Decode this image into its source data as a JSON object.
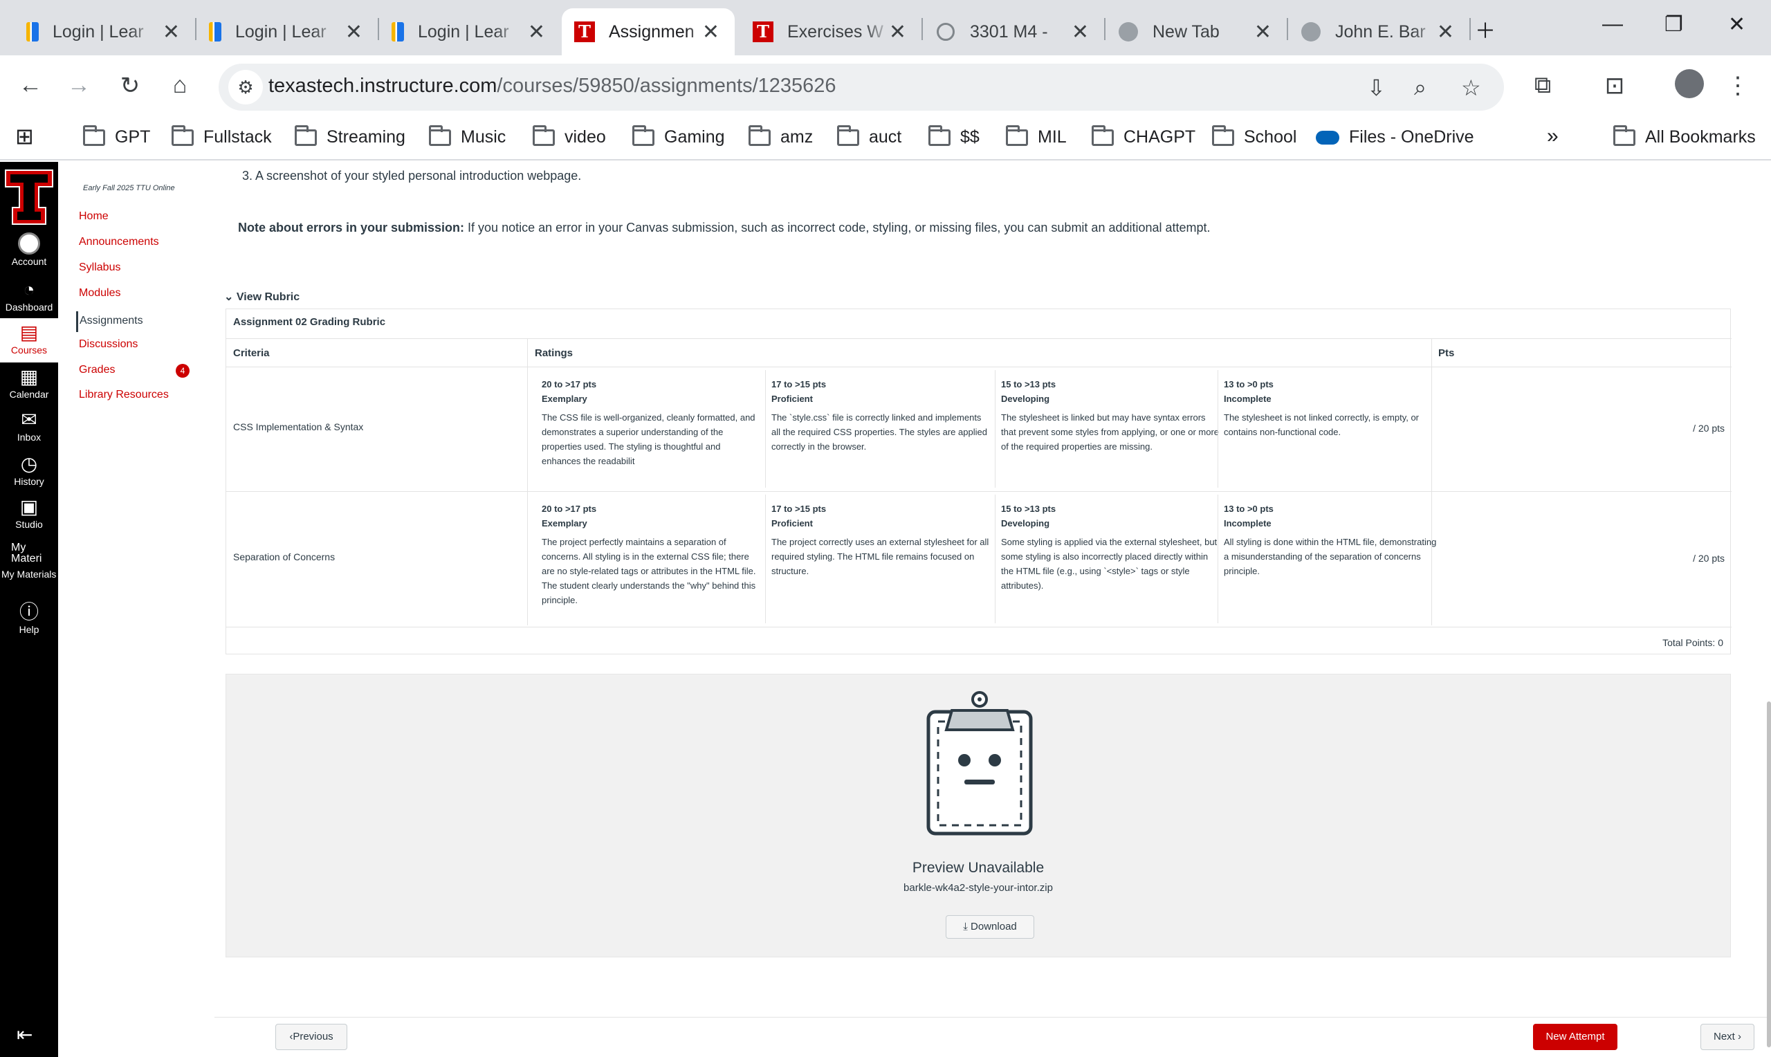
{
  "browser": {
    "tabs": [
      {
        "title": "Login | Lear",
        "icon": "learning-favicon"
      },
      {
        "title": "Login | Lear",
        "icon": "learning-favicon"
      },
      {
        "title": "Login | Lear",
        "icon": "learning-favicon"
      },
      {
        "title": "Assignmen",
        "icon": "texas-tech-favicon",
        "active": true
      },
      {
        "title": "Exercises W",
        "icon": "texas-tech-favicon"
      },
      {
        "title": "3301 M4 -",
        "icon": "openai-favicon"
      },
      {
        "title": "New Tab",
        "icon": "globe-favicon"
      },
      {
        "title": "John E. Bar",
        "icon": "globe-favicon"
      }
    ],
    "url_host": "texastech.instructure.com",
    "url_path": "/courses/59850/assignments/1235626",
    "bookmarks": [
      "GPT",
      "Fullstack",
      "Streaming",
      "Music",
      "video",
      "Gaming",
      "amz",
      "auct",
      "$$",
      "MIL",
      "CHAGPT",
      "School",
      "Files - OneDrive"
    ],
    "all_bookmarks": "All Bookmarks"
  },
  "global_nav": {
    "items": [
      {
        "label": "Account",
        "icon": "account-icon"
      },
      {
        "label": "Dashboard",
        "icon": "dashboard-icon"
      },
      {
        "label": "Courses",
        "icon": "courses-icon"
      },
      {
        "label": "Calendar",
        "icon": "calendar-icon"
      },
      {
        "label": "Inbox",
        "icon": "inbox-icon"
      },
      {
        "label": "History",
        "icon": "history-icon"
      },
      {
        "label": "Studio",
        "icon": "studio-icon"
      },
      {
        "label": "My Materials",
        "icon": "my-materials-icon",
        "alt": "My Materi"
      },
      {
        "label": "Help",
        "icon": "help-icon"
      }
    ]
  },
  "course_nav": {
    "term": "Early Fall 2025 TTU Online",
    "items": [
      "Home",
      "Announcements",
      "Syllabus",
      "Modules",
      "Assignments",
      "Discussions",
      "Grades",
      "Library Resources"
    ],
    "grades_badge": "4"
  },
  "content": {
    "instruction_3": "3. A screenshot of your styled personal introduction webpage.",
    "note_label": "Note about errors in your submission:",
    "note_text": " If you notice an error in your Canvas submission, such as incorrect code, styling, or missing files, you can submit an additional attempt.",
    "view_rubric": "View Rubric"
  },
  "rubric": {
    "title": "Assignment 02 Grading Rubric",
    "headers": {
      "criteria": "Criteria",
      "ratings": "Ratings",
      "pts": "Pts"
    },
    "rows": [
      {
        "criterion": "CSS Implementation & Syntax",
        "points": "/ 20 pts",
        "ratings": [
          {
            "range": "20 to >17 pts",
            "level": "Exemplary",
            "desc": "The CSS file is well-organized, cleanly formatted, and demonstrates a superior understanding of the properties used. The styling is thoughtful and enhances the readabilit"
          },
          {
            "range": "17 to >15 pts",
            "level": "Proficient",
            "desc": "The `style.css` file is correctly linked and implements all the required CSS properties. The styles are applied correctly in the browser."
          },
          {
            "range": "15 to >13 pts",
            "level": "Developing",
            "desc": "The stylesheet is linked but may have syntax errors that prevent some styles from applying, or one or more of the required properties are missing."
          },
          {
            "range": "13 to >0 pts",
            "level": "Incomplete",
            "desc": "The stylesheet is not linked correctly, is empty, or contains non-functional code."
          }
        ]
      },
      {
        "criterion": "Separation of Concerns",
        "points": "/ 20 pts",
        "ratings": [
          {
            "range": "20 to >17 pts",
            "level": "Exemplary",
            "desc": "The project perfectly maintains a separation of concerns. All styling is in the external CSS file; there are no style-related tags or attributes in the HTML file. The student clearly understands the \"why\" behind this principle."
          },
          {
            "range": "17 to >15 pts",
            "level": "Proficient",
            "desc": "The project correctly uses an external stylesheet for all required styling. The HTML file remains focused on structure."
          },
          {
            "range": "15 to >13 pts",
            "level": "Developing",
            "desc": "Some styling is applied via the external stylesheet, but some styling is also incorrectly placed directly within the HTML file (e.g., using `<style>` tags or style attributes)."
          },
          {
            "range": "13 to >0 pts",
            "level": "Incomplete",
            "desc": "All styling is done within the HTML file, demonstrating a misunderstanding of the separation of concerns principle."
          }
        ]
      }
    ],
    "total": "Total Points: 0"
  },
  "preview": {
    "title": "Preview Unavailable",
    "filename": "barkle-wk4a2-style-your-intor.zip",
    "download": "Download"
  },
  "footer": {
    "previous": "Previous",
    "new_attempt": "New Attempt",
    "next": "Next"
  },
  "colors": {
    "accent": "#cc0000",
    "nav_bg": "#000000"
  }
}
